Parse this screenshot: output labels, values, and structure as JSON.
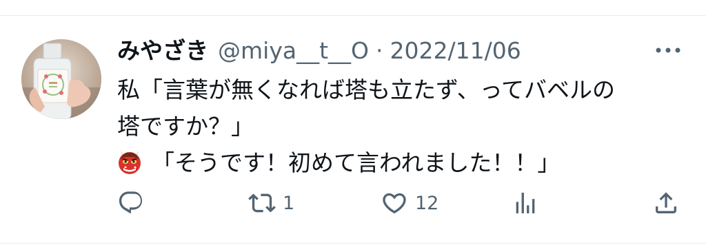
{
  "tweet": {
    "author_name": "みやざき",
    "author_handle": "@miya__t__O",
    "separator": "·",
    "date": "2022/11/06",
    "body_lines": [
      "私「言葉が無くなれば塔も立たず、ってバベルの",
      "塔ですか？」",
      "「そうです！初めて言われました！！」"
    ],
    "emoji_icon": "red-oni-mask-icon"
  },
  "actions": {
    "reply_icon": "reply-icon",
    "retweet_icon": "retweet-icon",
    "retweet_count": "1",
    "like_icon": "heart-icon",
    "like_count": "12",
    "views_icon": "analytics-icon",
    "share_icon": "share-icon"
  },
  "colors": {
    "text_primary": "#0f1419",
    "text_secondary": "#536471",
    "divider": "#e7e9eb"
  }
}
